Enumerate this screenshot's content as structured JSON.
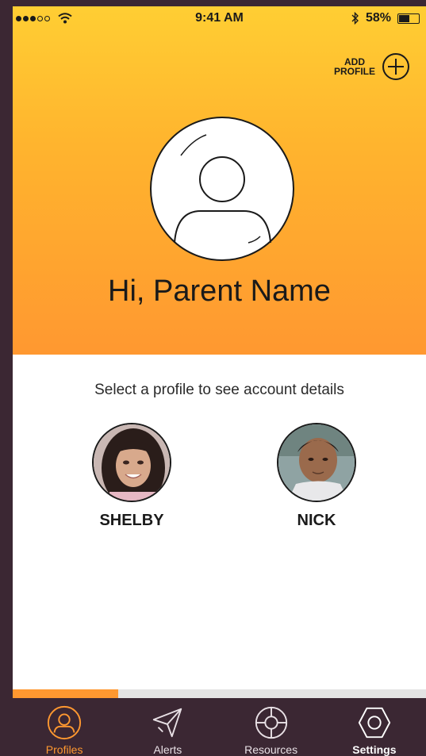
{
  "status_bar": {
    "time": "9:41 AM",
    "battery": "58%",
    "battery_level": 0.58
  },
  "header": {
    "add_profile_label": "ADD\nPROFILE",
    "greeting": "Hi, Parent Name"
  },
  "content": {
    "subtitle": "Select a profile to see account details",
    "profiles": [
      {
        "name": "SHELBY"
      },
      {
        "name": "NICK"
      }
    ]
  },
  "progress": {
    "fraction": 0.255
  },
  "tabs": [
    {
      "label": "Profiles",
      "icon": "profile-icon",
      "active": true
    },
    {
      "label": "Alerts",
      "icon": "paper-plane-icon"
    },
    {
      "label": "Resources",
      "icon": "lifebuoy-icon"
    },
    {
      "label": "Settings",
      "icon": "hexagon-nut-icon"
    }
  ],
  "colors": {
    "accent": "#ff9830",
    "header_top": "#ffce33",
    "tabbar": "#3b2733"
  }
}
